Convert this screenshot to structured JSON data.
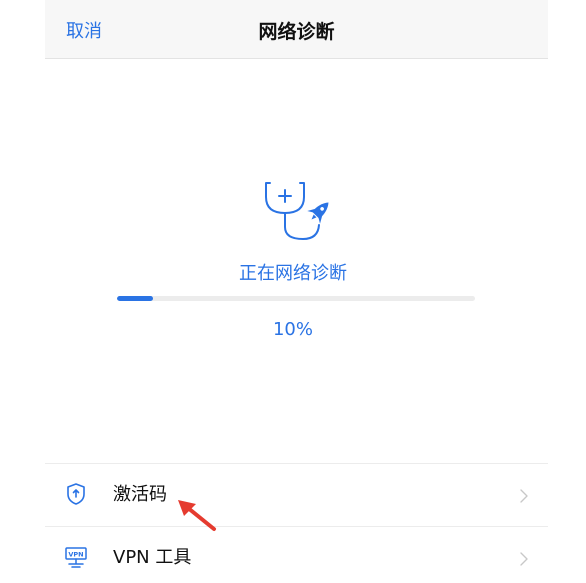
{
  "nav": {
    "cancel_label": "取消",
    "title": "网络诊断"
  },
  "diagnosis": {
    "icon": "stethoscope-rocket-icon",
    "status_text": "正在网络诊断",
    "progress_percent": 10,
    "progress_label": "10%"
  },
  "list": {
    "items": [
      {
        "icon": "shield-icon",
        "label": "激活码",
        "chevron": "chevron-right-icon"
      },
      {
        "icon": "vpn-monitor-icon",
        "label": "VPN 工具",
        "chevron": "chevron-right-icon"
      }
    ]
  },
  "colors": {
    "accent": "#2a73e4",
    "annotation": "#e53b2f",
    "nav_background": "#f7f7f7",
    "track": "#ececec"
  }
}
